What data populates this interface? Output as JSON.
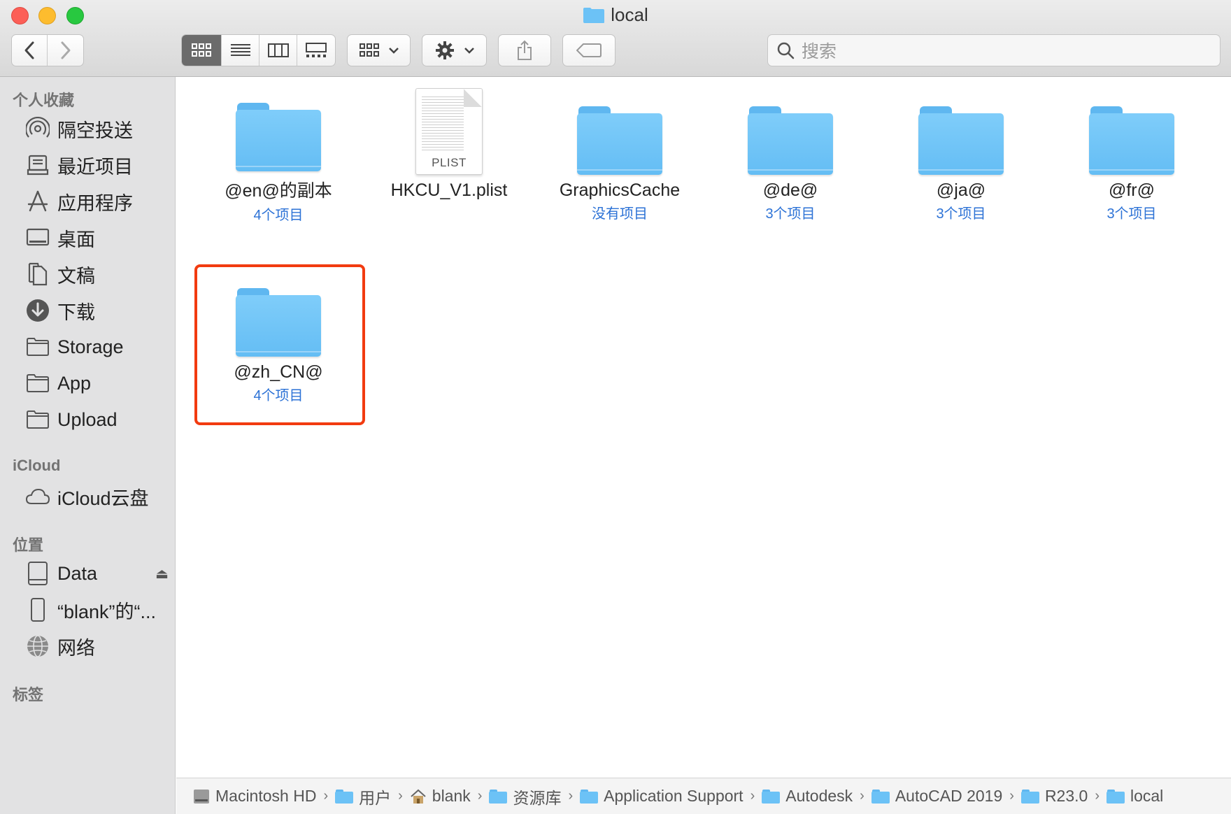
{
  "window": {
    "title": "local"
  },
  "toolbar": {
    "view_modes": [
      "icon-view",
      "list-view",
      "column-view",
      "gallery-view"
    ],
    "active_view": "icon-view",
    "group_icon": "grid-icon",
    "action_icon": "gear-icon",
    "share_icon": "share-icon",
    "tag_icon": "tag-icon",
    "search_placeholder": "搜索"
  },
  "sidebar": {
    "favorites_heading": "个人收藏",
    "favorites": [
      {
        "label": "隔空投送",
        "icon": "airdrop-icon"
      },
      {
        "label": "最近项目",
        "icon": "recents-icon"
      },
      {
        "label": "应用程序",
        "icon": "applications-icon"
      },
      {
        "label": "桌面",
        "icon": "desktop-icon"
      },
      {
        "label": "文稿",
        "icon": "documents-icon"
      },
      {
        "label": "下载",
        "icon": "downloads-icon"
      },
      {
        "label": "Storage",
        "icon": "folder-icon"
      },
      {
        "label": "App",
        "icon": "folder-icon"
      },
      {
        "label": "Upload",
        "icon": "folder-icon"
      }
    ],
    "icloud_heading": "iCloud",
    "icloud": [
      {
        "label": "iCloud云盘",
        "icon": "cloud-icon"
      }
    ],
    "locations_heading": "位置",
    "locations": [
      {
        "label": "Data",
        "icon": "disk-icon",
        "eject": "⏏"
      },
      {
        "label": "“blank”的“...",
        "icon": "ipod-icon"
      },
      {
        "label": "网络",
        "icon": "network-icon"
      }
    ],
    "tags_heading": "标签"
  },
  "content": {
    "items": [
      {
        "name": "@en@的副本",
        "count": "4个项目",
        "kind": "folder"
      },
      {
        "name": "HKCU_V1.plist",
        "count": "",
        "kind": "plist",
        "ext": "PLIST"
      },
      {
        "name": "GraphicsCache",
        "count": "没有项目",
        "kind": "folder"
      },
      {
        "name": "@de@",
        "count": "3个项目",
        "kind": "folder"
      },
      {
        "name": "@ja@",
        "count": "3个项目",
        "kind": "folder"
      },
      {
        "name": "@fr@",
        "count": "3个项目",
        "kind": "folder"
      },
      {
        "name": "@zh_CN@",
        "count": "4个项目",
        "kind": "folder",
        "highlighted": true
      }
    ],
    "highlight_color": "#f23b10"
  },
  "pathbar": {
    "crumbs": [
      {
        "label": "Macintosh HD",
        "icon": "hard-disk-icon"
      },
      {
        "label": "用户",
        "icon": "users-folder-icon"
      },
      {
        "label": "blank",
        "icon": "home-icon"
      },
      {
        "label": "资源库",
        "icon": "library-folder-icon"
      },
      {
        "label": "Application Support",
        "icon": "folder-icon"
      },
      {
        "label": "Autodesk",
        "icon": "folder-icon"
      },
      {
        "label": "AutoCAD 2019",
        "icon": "folder-icon"
      },
      {
        "label": "R23.0",
        "icon": "folder-icon"
      },
      {
        "label": "local",
        "icon": "folder-icon"
      }
    ],
    "separator": "›"
  }
}
